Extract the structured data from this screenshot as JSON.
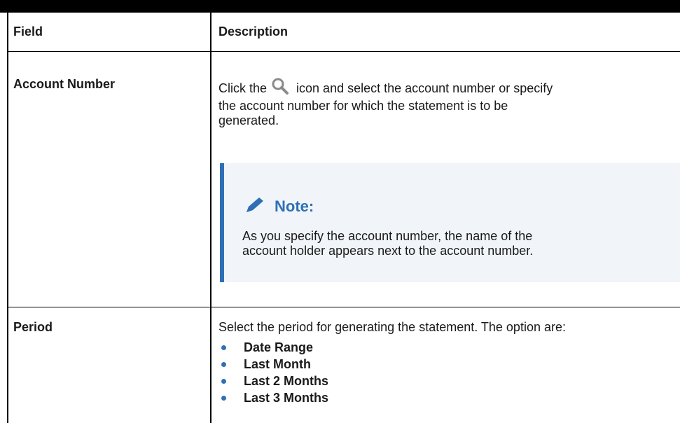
{
  "table": {
    "headers": {
      "field": "Field",
      "description": "Description"
    },
    "rows": {
      "account_number": {
        "field": "Account Number",
        "desc_prefix": "Click the",
        "desc_line1_rest": "icon and select the account number or specify",
        "desc_line2": "the account number for which the statement is to be",
        "desc_line3": "generated.",
        "icon": "search-icon",
        "note": {
          "title": "Note:",
          "icon": "pencil-icon",
          "line1": "As you specify the account number, the name of the",
          "line2": "account holder appears next to the account number."
        }
      },
      "period": {
        "field": "Period",
        "description": "Select the period for generating the statement. The option are:",
        "options": [
          "Date Range",
          "Last Month",
          "Last 2 Months",
          "Last 3 Months"
        ]
      }
    }
  },
  "colors": {
    "accent": "#2f6fb5",
    "note_bg": "#f1f5f9"
  }
}
